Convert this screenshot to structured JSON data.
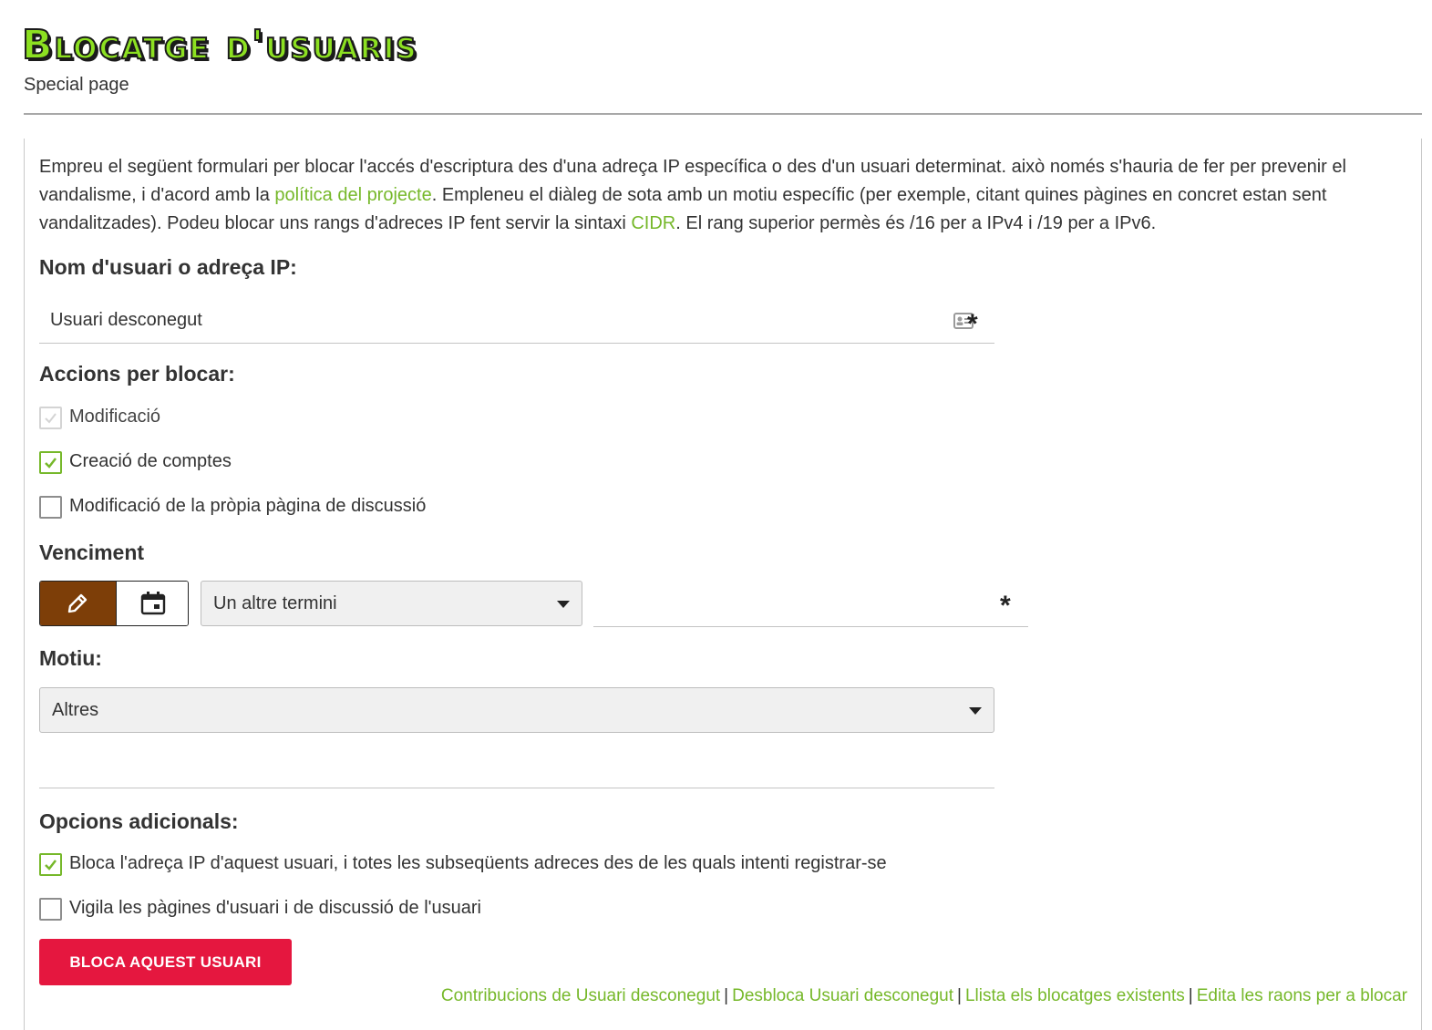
{
  "page": {
    "title": "Blocatge d'usuaris",
    "subtitle": "Special page"
  },
  "intro": {
    "part1": "Empreu el següent formulari per blocar l'accés d'escriptura des d'una adreça IP específica o des d'un usuari determinat. això només s'hauria de fer per prevenir el vandalisme, i d'acord amb la ",
    "policy_link": "política del projecte",
    "part2": ". Empleneu el diàleg de sota amb un motiu específic (per exemple, citant quines pàgines en concret estan sent vandalitzades). Podeu blocar uns rangs d'adreces IP fent servir la sintaxi ",
    "cidr_link": "CIDR",
    "part3": ". El rang superior permès és /16 per a IPv4 i /19 per a IPv6."
  },
  "target": {
    "label": "Nom d'usuari o adreça IP:",
    "value": "Usuari desconegut",
    "required_mark": "*"
  },
  "actions": {
    "label": "Accions per blocar:",
    "items": [
      {
        "label": "Modificació",
        "checked": true,
        "disabled": true
      },
      {
        "label": "Creació de comptes",
        "checked": true,
        "disabled": false
      },
      {
        "label": "Modificació de la pròpia pàgina de discussió",
        "checked": false,
        "disabled": false
      }
    ]
  },
  "expiry": {
    "label": "Venciment",
    "select_value": "Un altre termini",
    "required_mark": "*",
    "icons": {
      "mode_text": "pencil-icon",
      "mode_date": "calendar-icon"
    }
  },
  "reason": {
    "label": "Motiu:",
    "select_value": "Altres"
  },
  "options": {
    "label": "Opcions adicionals:",
    "items": [
      {
        "label": "Bloca l'adreça IP d'aquest usuari, i totes les subseqüents adreces des de les quals intenti registrar-se",
        "checked": true
      },
      {
        "label": "Vigila les pàgines d'usuari i de discussió de l'usuari",
        "checked": false
      }
    ]
  },
  "submit_label": "BLOCA AQUEST USUARI",
  "footer": {
    "links": [
      "Contribucions de Usuari desconegut",
      "Desbloca Usuari desconegut",
      "Llista els blocatges existents",
      "Edita les raons per a blocar"
    ],
    "separator": "|"
  },
  "colors": {
    "link": "#76b82a",
    "title_fill": "#8ce021",
    "submit_bg": "#e5173f",
    "active_toggle": "#7d3e08"
  }
}
